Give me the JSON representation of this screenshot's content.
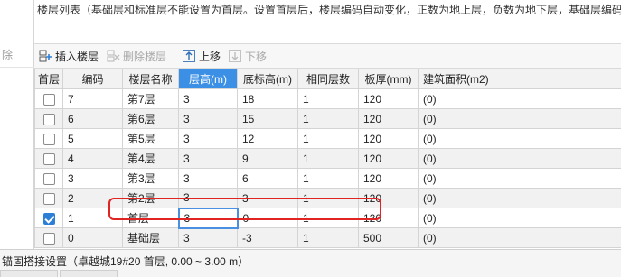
{
  "header": {
    "description": "楼层列表（基础层和标准层不能设置为首层。设置首层后，楼层编码自动变化，正数为地上层，负数为地下层，基础层编码"
  },
  "left_panel": {
    "delete_stub": "除"
  },
  "toolbar": {
    "insert_floor": "插入楼层",
    "delete_floor": "删除楼层",
    "move_up": "上移",
    "move_down": "下移"
  },
  "table": {
    "columns": [
      "首层",
      "编码",
      "楼层名称",
      "层高(m)",
      "底标高(m)",
      "相同层数",
      "板厚(mm)",
      "建筑面积(m2)"
    ],
    "rows": [
      {
        "first_floor": false,
        "code": "7",
        "name": "第7层",
        "height": "3",
        "bottom_elev": "18",
        "same_count": "1",
        "slab": "120",
        "area": "(0)"
      },
      {
        "first_floor": false,
        "code": "6",
        "name": "第6层",
        "height": "3",
        "bottom_elev": "15",
        "same_count": "1",
        "slab": "120",
        "area": "(0)"
      },
      {
        "first_floor": false,
        "code": "5",
        "name": "第5层",
        "height": "3",
        "bottom_elev": "12",
        "same_count": "1",
        "slab": "120",
        "area": "(0)"
      },
      {
        "first_floor": false,
        "code": "4",
        "name": "第4层",
        "height": "3",
        "bottom_elev": "9",
        "same_count": "1",
        "slab": "120",
        "area": "(0)"
      },
      {
        "first_floor": false,
        "code": "3",
        "name": "第3层",
        "height": "3",
        "bottom_elev": "6",
        "same_count": "1",
        "slab": "120",
        "area": "(0)"
      },
      {
        "first_floor": false,
        "code": "2",
        "name": "第2层",
        "height": "3",
        "bottom_elev": "3",
        "same_count": "1",
        "slab": "120",
        "area": "(0)"
      },
      {
        "first_floor": true,
        "code": "1",
        "name": "首层",
        "height": "3",
        "bottom_elev": "0",
        "same_count": "1",
        "slab": "120",
        "area": "(0)"
      },
      {
        "first_floor": false,
        "code": "0",
        "name": "基础层",
        "height": "3",
        "bottom_elev": "-3",
        "same_count": "1",
        "slab": "500",
        "area": "(0)"
      }
    ]
  },
  "statusbar": {
    "text": "锚固搭接设置（卓越城19#20  首层, 0.00 ~ 3.00 m）"
  },
  "colors": {
    "selected_header": "#3b8fe4",
    "checkbox": "#2d7fd6",
    "highlight": "#e02424"
  }
}
